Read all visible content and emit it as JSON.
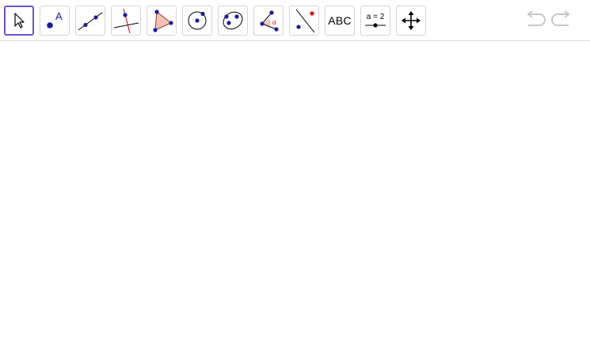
{
  "toolbar": {
    "tools": [
      {
        "id": "move",
        "icon": "move-pointer-icon",
        "selected": true
      },
      {
        "id": "point",
        "icon": "point-icon",
        "label": "A"
      },
      {
        "id": "line",
        "icon": "line-through-two-points-icon"
      },
      {
        "id": "perpendicular",
        "icon": "perpendicular-line-icon"
      },
      {
        "id": "polygon",
        "icon": "polygon-icon"
      },
      {
        "id": "circle",
        "icon": "circle-center-point-icon"
      },
      {
        "id": "ellipse",
        "icon": "ellipse-icon"
      },
      {
        "id": "angle",
        "icon": "angle-icon",
        "label": "α"
      },
      {
        "id": "reflect",
        "icon": "reflect-about-line-icon"
      },
      {
        "id": "text",
        "icon": "text-icon",
        "label": "ABC"
      },
      {
        "id": "slider",
        "icon": "slider-icon",
        "label": "a = 2"
      },
      {
        "id": "move-graphics-view",
        "icon": "move-graphics-view-icon"
      }
    ],
    "undo_icon": "undo-icon",
    "redo_icon": "redo-icon"
  },
  "colors": {
    "selected_border": "#6557d2",
    "point_blue": "#1a1aa6",
    "accent_red": "#cc0000",
    "polygon_fill": "#f5c2b5"
  }
}
